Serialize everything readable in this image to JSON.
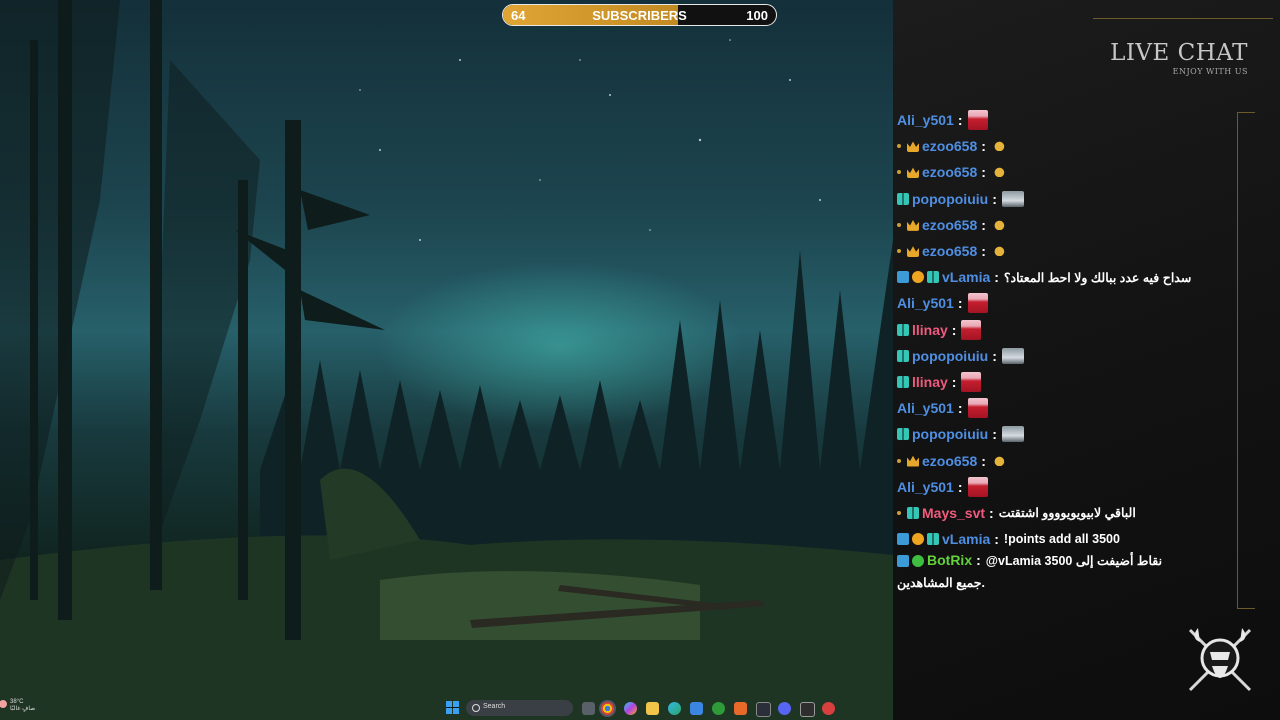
{
  "goal": {
    "current": "64",
    "label": "SUBSCRIBERS",
    "target": "100",
    "progress_fraction": 0.64
  },
  "chat": {
    "title": "LIVE CHAT",
    "subtitle": "ENJOY WITH US",
    "messages": [
      {
        "user": "Ali_y501",
        "color": "#4f8fe3",
        "badges": [],
        "content_type": "avatar-red"
      },
      {
        "user": "ezoo658",
        "color": "#4f8fe3",
        "badges": [
          "dot",
          "crown"
        ],
        "content_type": "emote"
      },
      {
        "user": "ezoo658",
        "color": "#4f8fe3",
        "badges": [
          "dot",
          "crown"
        ],
        "content_type": "emote"
      },
      {
        "user": "popopoiuiu",
        "color": "#4f8fe3",
        "badges": [
          "bar"
        ],
        "content_type": "avatar-car"
      },
      {
        "user": "ezoo658",
        "color": "#4f8fe3",
        "badges": [
          "dot",
          "crown"
        ],
        "content_type": "emote"
      },
      {
        "user": "ezoo658",
        "color": "#4f8fe3",
        "badges": [
          "dot",
          "crown"
        ],
        "content_type": "emote"
      },
      {
        "user": "vLamia",
        "color": "#4f8fe3",
        "badges": [
          "share",
          "coin",
          "bar"
        ],
        "text": "سداح فيه عدد ببالك ولا احط المعتاد؟"
      },
      {
        "user": "Ali_y501",
        "color": "#4f8fe3",
        "badges": [],
        "content_type": "avatar-red"
      },
      {
        "user": "llinay",
        "color": "#f05a7e",
        "badges": [
          "bar"
        ],
        "content_type": "avatar-red"
      },
      {
        "user": "popopoiuiu",
        "color": "#4f8fe3",
        "badges": [
          "bar"
        ],
        "content_type": "avatar-car"
      },
      {
        "user": "llinay",
        "color": "#f05a7e",
        "badges": [
          "bar"
        ],
        "content_type": "avatar-red"
      },
      {
        "user": "Ali_y501",
        "color": "#4f8fe3",
        "badges": [],
        "content_type": "avatar-red"
      },
      {
        "user": "popopoiuiu",
        "color": "#4f8fe3",
        "badges": [
          "bar"
        ],
        "content_type": "avatar-car"
      },
      {
        "user": "ezoo658",
        "color": "#4f8fe3",
        "badges": [
          "dot",
          "crown"
        ],
        "content_type": "emote"
      },
      {
        "user": "Ali_y501",
        "color": "#4f8fe3",
        "badges": [],
        "content_type": "avatar-red"
      },
      {
        "user": "Mays_svt",
        "color": "#f05a7e",
        "badges": [
          "dot",
          "bar"
        ],
        "text": "الباقي لابيويويوووو اشتقتت"
      },
      {
        "user": "vLamia",
        "color": "#4f8fe3",
        "badges": [
          "share",
          "coin",
          "bar"
        ],
        "text": "!points add all 3500"
      },
      {
        "user": "BotRix",
        "color": "#62d33a",
        "badges": [
          "share",
          "check"
        ],
        "text": "@vLamia 3500 نقاط أضيفت إلى جميع المشاهدين."
      }
    ]
  },
  "taskbar": {
    "weather_temp": "38°C",
    "weather_desc": "صافٍ غالبًا",
    "search_placeholder": "Search",
    "icons": [
      "start-icon",
      "search",
      "task-view-icon",
      "chrome-icon",
      "copilot-icon",
      "file-explorer-icon",
      "edge-icon",
      "store-icon",
      "xbox-icon",
      "app-icon",
      "office-icon",
      "app-icon",
      "discord-icon",
      "app-icon",
      "app-icon"
    ]
  }
}
